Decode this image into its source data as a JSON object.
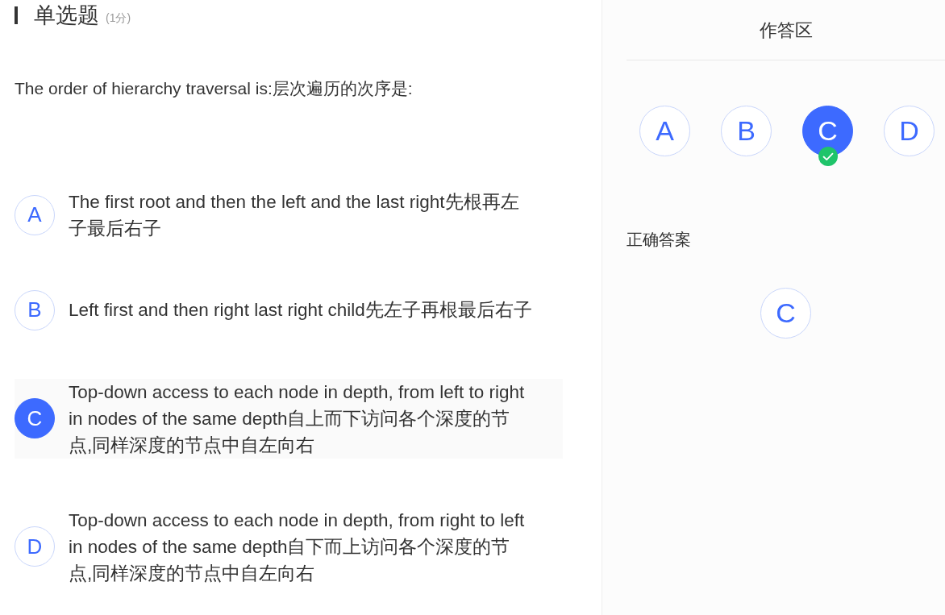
{
  "header": {
    "title": "单选题",
    "score": "(1分)"
  },
  "question": "The order of hierarchy traversal is:层次遍历的次序是:",
  "options": [
    {
      "letter": "A",
      "text": "The first root and then the left and the last right先根再左子最后右子",
      "selected": false
    },
    {
      "letter": "B",
      "text": "Left first and then right last right child先左子再根最后右子",
      "selected": false
    },
    {
      "letter": "C",
      "text": "Top-down access to each node in depth, from left to right in nodes of the same depth自上而下访问各个深度的节点,同样深度的节点中自左向右",
      "selected": true
    },
    {
      "letter": "D",
      "text": "Top-down access to each node in depth, from right to left in nodes of the same depth自下而上访问各个深度的节点,同样深度的节点中自左向右",
      "selected": false
    }
  ],
  "answer_sheet": {
    "title": "作答区",
    "choices": [
      {
        "letter": "A",
        "selected": false,
        "correct": false
      },
      {
        "letter": "B",
        "selected": false,
        "correct": false
      },
      {
        "letter": "C",
        "selected": true,
        "correct": true
      },
      {
        "letter": "D",
        "selected": false,
        "correct": false
      }
    ],
    "correct_label": "正确答案",
    "correct_answer": "C"
  }
}
